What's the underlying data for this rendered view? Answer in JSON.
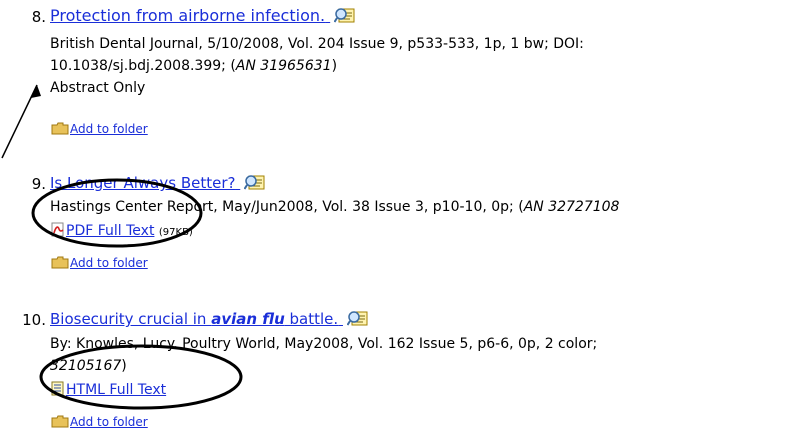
{
  "results": [
    {
      "number": "8.",
      "title": "Protection from airborne infection.",
      "meta_line1": "British Dental Journal, 5/10/2008, Vol. 204 Issue 9, p533-533, 1p, 1 bw; DOI:",
      "meta_line2_text": "10.1038/sj.bdj.2008.399; (",
      "meta_line2_an": "AN 31965631",
      "meta_line2_end": ")",
      "availability": "Abstract Only",
      "folder_label": "Add to folder"
    },
    {
      "number": "9.",
      "title": "Is Longer Always Better?",
      "meta_text": "Hastings Center Report, May/Jun2008, Vol. 38 Issue 3, p10-10, 0p; (",
      "meta_an": "AN 32727108",
      "fulltext_label": "PDF Full Text",
      "fulltext_size": "(97KB)",
      "folder_label": "Add to folder"
    },
    {
      "number": "10.",
      "title_pre": "Biosecurity crucial in ",
      "title_em": "avian flu",
      "title_post": " battle.",
      "meta_line1": "By: Knowles, Lucy. Poultry World, May2008, Vol. 162 Issue 5, p6-6, 0p, 2 color;",
      "meta_line2_an": "32105167",
      "meta_line2_end": ")",
      "fulltext_label": "HTML Full Text",
      "folder_label": "Add to folder"
    }
  ],
  "colors": {
    "link": "#1a2ed8",
    "folder": "#e8c25a",
    "pdf": "#d42020"
  }
}
